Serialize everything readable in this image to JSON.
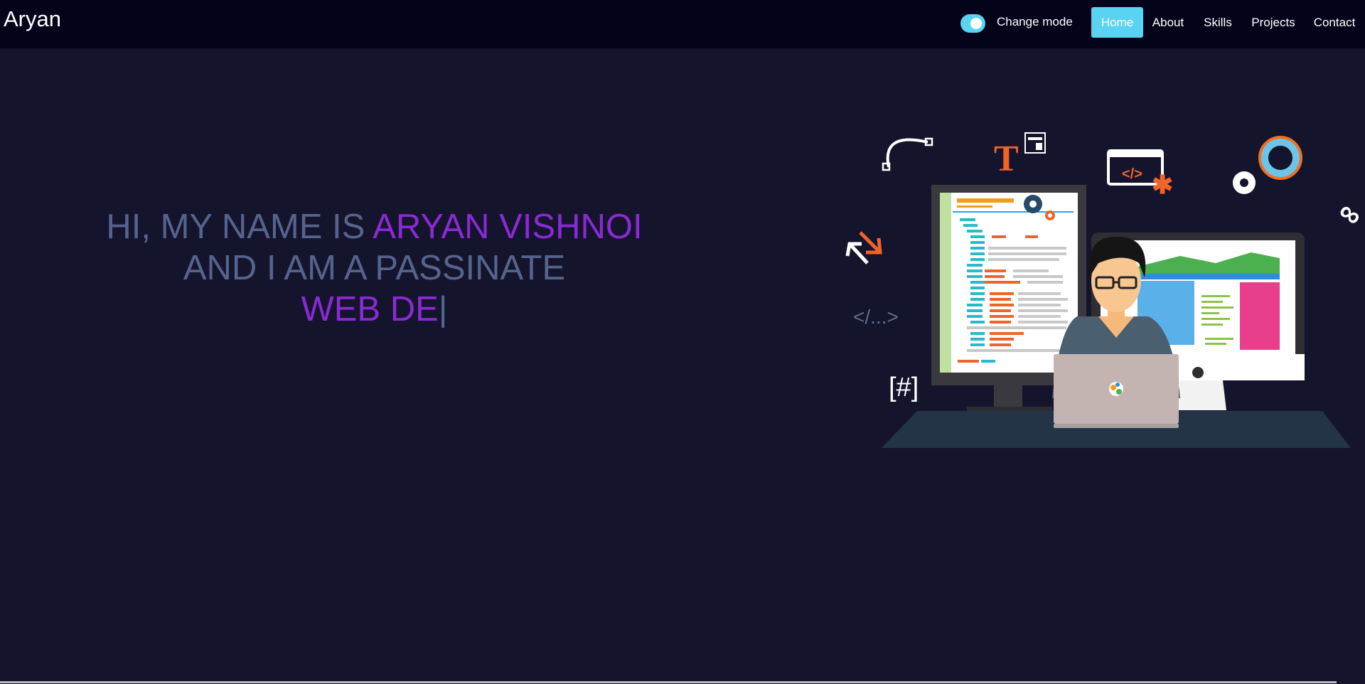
{
  "brand": "Aryan",
  "mode_toggle": {
    "label": "Change mode",
    "state": "on",
    "color": "#5ad2f2"
  },
  "nav": {
    "items": [
      {
        "label": "Home",
        "active": true
      },
      {
        "label": "About",
        "active": false
      },
      {
        "label": "Skills",
        "active": false
      },
      {
        "label": "Projects",
        "active": false
      },
      {
        "label": "Contact",
        "active": false
      }
    ]
  },
  "hero": {
    "line1_prefix": "HI, MY NAME IS ",
    "line1_name": "ARYAN VISHNOI",
    "line2": "AND I AM A PASSINATE",
    "line3_typed": "WEB DE",
    "cursor": "|"
  },
  "illustration": {
    "code_tag": "</...>",
    "hash_tag": "[#]",
    "title_letter": "T",
    "code_symbol": "</>"
  },
  "colors": {
    "background": "#15142d",
    "navbar": "#03031a",
    "text_muted": "#55648d",
    "accent_purple": "#8a2ad4",
    "accent_orange": "#f0642a",
    "accent_blue": "#5ad2f2"
  }
}
